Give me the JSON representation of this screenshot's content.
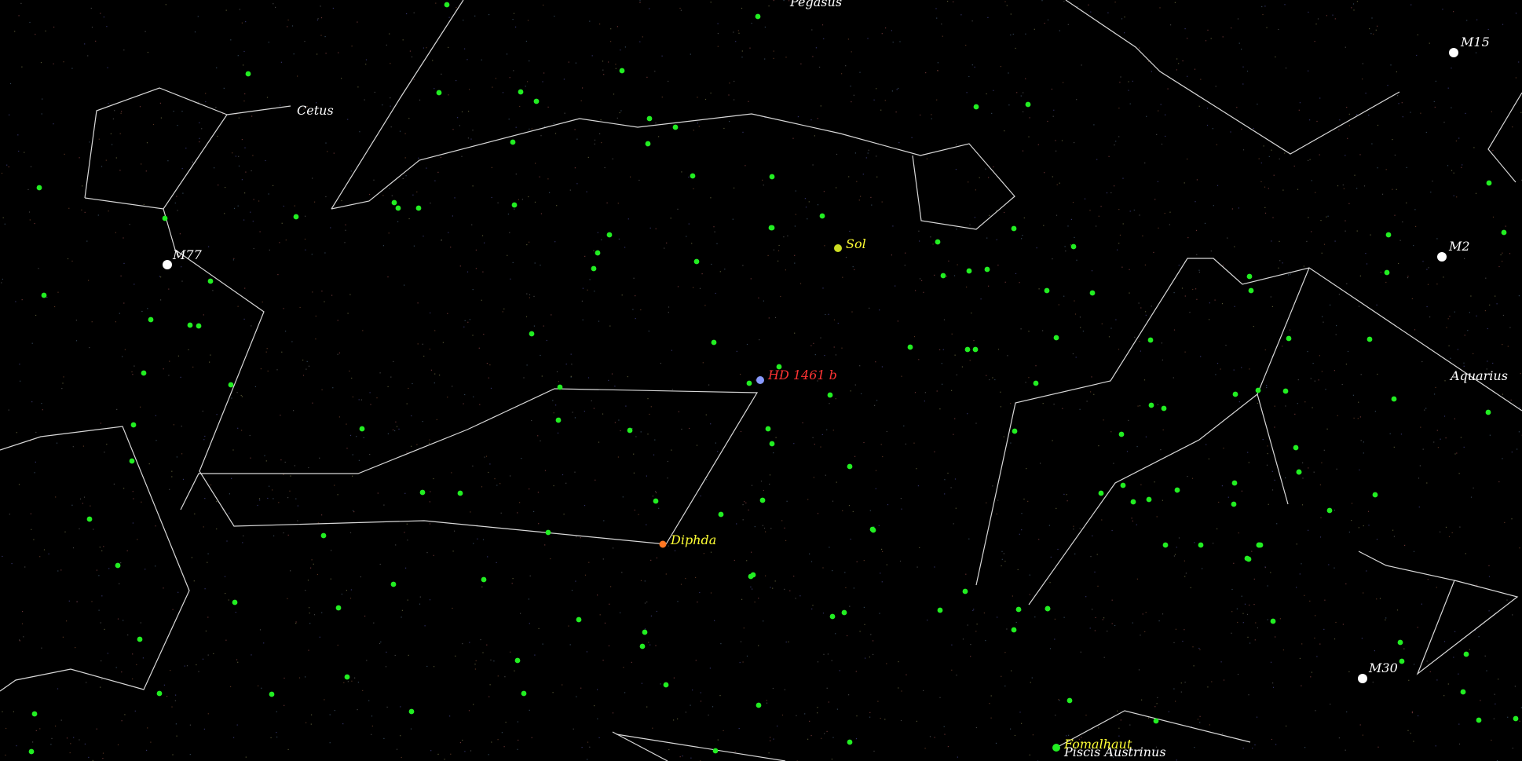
{
  "labels": {
    "pegasus": "Pegasus",
    "cetus": "Cetus",
    "aquarius": "Aquarius",
    "piscis_austrinus": "Piscis Austrinus",
    "m15": "M15",
    "m2": "M2",
    "m77": "M77",
    "m30": "M30",
    "sol": "Sol",
    "hd1461b": "HD 1461 b",
    "diphda": "Diphda",
    "fomalhaut": "Fomalhaut"
  },
  "colors": {
    "background": "#000000",
    "constellation_line": "#d8d8d8",
    "constellation_label": "#ffffff",
    "messier": "#ffffff",
    "star_label": "#ffff33",
    "target_label": "#ff3333",
    "field_star": "#22ee22",
    "diphda": "#ff7722",
    "target_planet": "#8899ff"
  }
}
